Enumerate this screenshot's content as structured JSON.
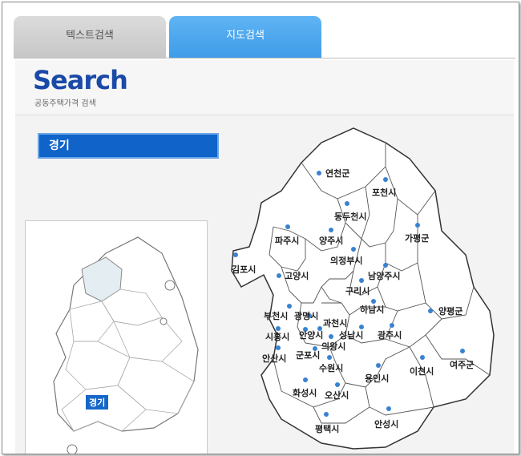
{
  "tabs": [
    {
      "label": "텍스트검색",
      "active": false
    },
    {
      "label": "지도검색",
      "active": true
    }
  ],
  "header": {
    "title": "Search",
    "subtitle": "공동주택가격 검색"
  },
  "region": {
    "selected": "경기",
    "mini_label": "경기"
  },
  "colors": {
    "accent": "#1063c8",
    "tab_active": "#4aa6ee",
    "title": "#1a4aa8",
    "dot": "#3a82d0"
  },
  "cities": [
    {
      "name": "연천군"
    },
    {
      "name": "포천시"
    },
    {
      "name": "동두천시"
    },
    {
      "name": "가평군"
    },
    {
      "name": "파주시"
    },
    {
      "name": "양주시"
    },
    {
      "name": "의정부시"
    },
    {
      "name": "김포시"
    },
    {
      "name": "고양시"
    },
    {
      "name": "남양주시"
    },
    {
      "name": "구리시"
    },
    {
      "name": "하남시"
    },
    {
      "name": "양평군"
    },
    {
      "name": "부천시"
    },
    {
      "name": "광명시"
    },
    {
      "name": "과천시"
    },
    {
      "name": "시흥시"
    },
    {
      "name": "안양시"
    },
    {
      "name": "성남시"
    },
    {
      "name": "광주시"
    },
    {
      "name": "의왕시"
    },
    {
      "name": "군포시"
    },
    {
      "name": "안산시"
    },
    {
      "name": "수원시"
    },
    {
      "name": "이천시"
    },
    {
      "name": "여주군"
    },
    {
      "name": "용인시"
    },
    {
      "name": "화성시"
    },
    {
      "name": "오산시"
    },
    {
      "name": "평택시"
    },
    {
      "name": "안성시"
    }
  ]
}
